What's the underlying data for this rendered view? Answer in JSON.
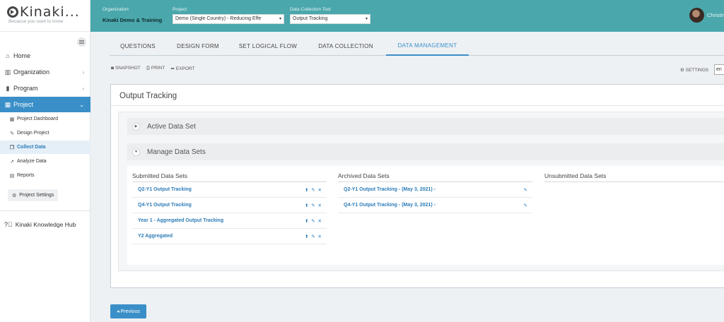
{
  "brand": {
    "name": "Kinaki...",
    "tagline": "Because you want to know"
  },
  "topbar": {
    "org_label": "Organization",
    "org_value": "Kinaki Demo & Training",
    "project_label": "Project",
    "project_value": "Demo (Single Country) - Reducing Effe",
    "tool_label": "Data Collection Tool",
    "tool_value": "Output Tracking",
    "user_name": "Christine"
  },
  "sidebar": {
    "items": [
      {
        "label": "Home",
        "icon": "home-icon"
      },
      {
        "label": "Organization",
        "icon": "building-icon"
      },
      {
        "label": "Program",
        "icon": "bars-icon"
      },
      {
        "label": "Project",
        "icon": "grid-icon"
      }
    ],
    "subitems": [
      {
        "label": "Project Dashboard"
      },
      {
        "label": "Design Project"
      },
      {
        "label": "Collect Data"
      },
      {
        "label": "Analyze Data"
      },
      {
        "label": "Reports"
      }
    ],
    "project_settings": "Project Settings",
    "knowledge_hub": "Kinaki Knowledge Hub"
  },
  "tabs": [
    "QUESTIONS",
    "DESIGN FORM",
    "SET LOGICAL FLOW",
    "DATA COLLECTION",
    "DATA MANAGEMENT"
  ],
  "active_tab": "DATA MANAGEMENT",
  "toolbar": {
    "snapshot": "SNAPSHOT",
    "print": "PRINT",
    "export": "EXPORT",
    "settings": "SETTINGS",
    "lang": "en"
  },
  "panel": {
    "title": "Output Tracking",
    "active_data_set": "Active Data Set",
    "manage_data_sets": "Manage Data Sets",
    "submitted_title": "Submitted Data Sets",
    "archived_title": "Archived Data Sets",
    "unsubmitted_title": "Unsubmitted Data Sets",
    "submitted": [
      "Q2-Y1 Output Tracking",
      "Q4-Y1 Output Tracking",
      "Year 1 - Aggregated Output Tracking",
      "Y2 Aggregated"
    ],
    "archived": [
      "Q2-Y1 Output Tracking - (May 3, 2021) -",
      "Q4-Y1 Output Tracking - (May 3, 2021) -"
    ]
  },
  "previous_label": "Previous",
  "colors": {
    "topbar": "#4aa7ac",
    "accent": "#3a8fc8",
    "link": "#2c7cb8"
  }
}
